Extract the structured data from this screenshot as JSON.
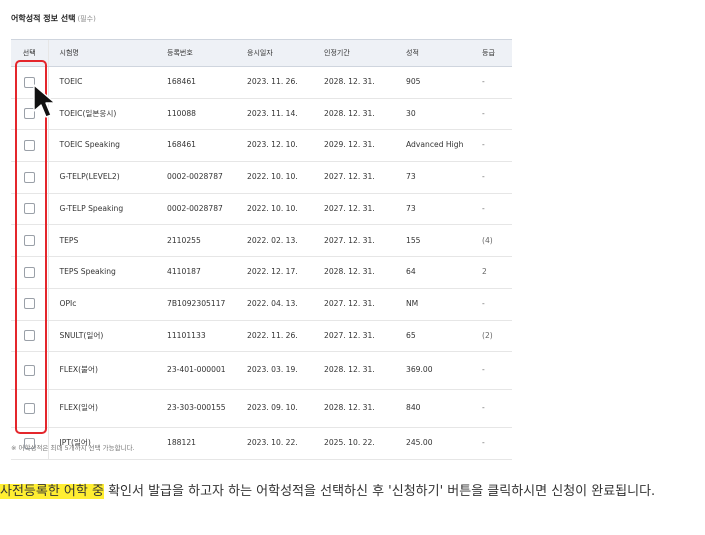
{
  "section": {
    "title": "어학성적 정보 선택",
    "required_note": "(필수)"
  },
  "table": {
    "headers": {
      "select": "선택",
      "name": "시험명",
      "reg_no": "등록번호",
      "exam_date": "응시일자",
      "valid_until": "인정기간",
      "score": "성적",
      "grade": "등급"
    },
    "rows": [
      {
        "name": "TOEIC",
        "reg_no": "168461",
        "exam_date": "2023. 11. 26.",
        "valid_until": "2028. 12. 31.",
        "score": "905",
        "grade": "-"
      },
      {
        "name": "TOEIC(일본응시)",
        "reg_no": "110088",
        "exam_date": "2023. 11. 14.",
        "valid_until": "2028. 12. 31.",
        "score": "30",
        "grade": "-"
      },
      {
        "name": "TOEIC Speaking",
        "reg_no": "168461",
        "exam_date": "2023. 12. 10.",
        "valid_until": "2029. 12. 31.",
        "score": "Advanced High",
        "grade": "-"
      },
      {
        "name": "G-TELP(LEVEL2)",
        "reg_no": "0002-0028787",
        "exam_date": "2022. 10. 10.",
        "valid_until": "2027. 12. 31.",
        "score": "73",
        "grade": "-"
      },
      {
        "name": "G-TELP Speaking",
        "reg_no": "0002-0028787",
        "exam_date": "2022. 10. 10.",
        "valid_until": "2027. 12. 31.",
        "score": "73",
        "grade": "-"
      },
      {
        "name": "TEPS",
        "reg_no": "2110255",
        "exam_date": "2022. 02. 13.",
        "valid_until": "2027. 12. 31.",
        "score": "155",
        "grade": "(4)"
      },
      {
        "name": "TEPS Speaking",
        "reg_no": "4110187",
        "exam_date": "2022. 12. 17.",
        "valid_until": "2028. 12. 31.",
        "score": "64",
        "grade": "2"
      },
      {
        "name": "OPIc",
        "reg_no": "7B1092305117",
        "exam_date": "2022. 04. 13.",
        "valid_until": "2027. 12. 31.",
        "score": "NM",
        "grade": "-"
      },
      {
        "name": "SNULT(일어)",
        "reg_no": "11101133",
        "exam_date": "2022. 11. 26.",
        "valid_until": "2027. 12. 31.",
        "score": "65",
        "grade": "(2)"
      },
      {
        "name": "FLEX(불어)",
        "reg_no": "23-401-000001",
        "exam_date": "2023. 03. 19.",
        "valid_until": "2028. 12. 31.",
        "score": "369.00",
        "grade": "-"
      },
      {
        "name": "FLEX(일어)",
        "reg_no": "23-303-000155",
        "exam_date": "2023. 09. 10.",
        "valid_until": "2028. 12. 31.",
        "score": "840",
        "grade": "-"
      },
      {
        "name": "JPT(일어)",
        "reg_no": "188121",
        "exam_date": "2023. 10. 22.",
        "valid_until": "2025. 10. 22.",
        "score": "245.00",
        "grade": "-"
      }
    ]
  },
  "footnote": "※ 어학성적은 최대 5개까지 선택 가능합니다.",
  "description": {
    "highlighted": "사전등록한 어학 중",
    "rest": " 확인서 발급을 하고자 하는 어학성적을 선택하신 후 '신청하기' 버튼을 클릭하시면 신청이 완료됩니다."
  },
  "colors": {
    "highlight_box": "#e4262c",
    "text_highlight": "#ffee32",
    "header_bg": "#eef1f6"
  },
  "icons": {
    "cursor": "arrow-cursor-icon",
    "checkbox": "checkbox-unchecked"
  }
}
